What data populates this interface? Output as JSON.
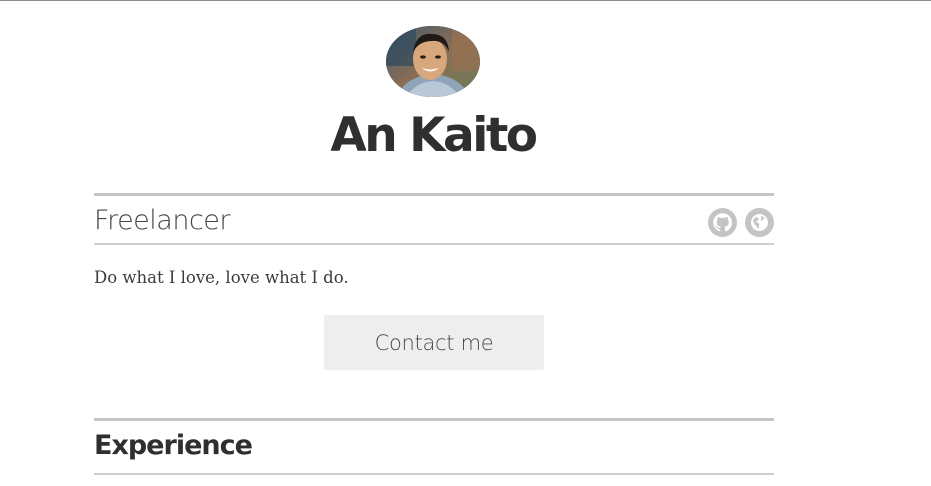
{
  "profile": {
    "name": "An Kaito",
    "role": "Freelancer",
    "tagline": "Do what I love, love what I do.",
    "avatar_icon": "profile-photo"
  },
  "links": [
    {
      "icon": "github-icon",
      "kind": "GitHub"
    },
    {
      "icon": "globe-icon",
      "kind": "Website"
    }
  ],
  "actions": {
    "contact_label": "Contact me"
  },
  "sections": {
    "experience_title": "Experience"
  },
  "colors": {
    "text": "#333333",
    "rule": "#c6c6c6",
    "button_bg": "#eeeeee",
    "icon": "#c4c4c4"
  }
}
